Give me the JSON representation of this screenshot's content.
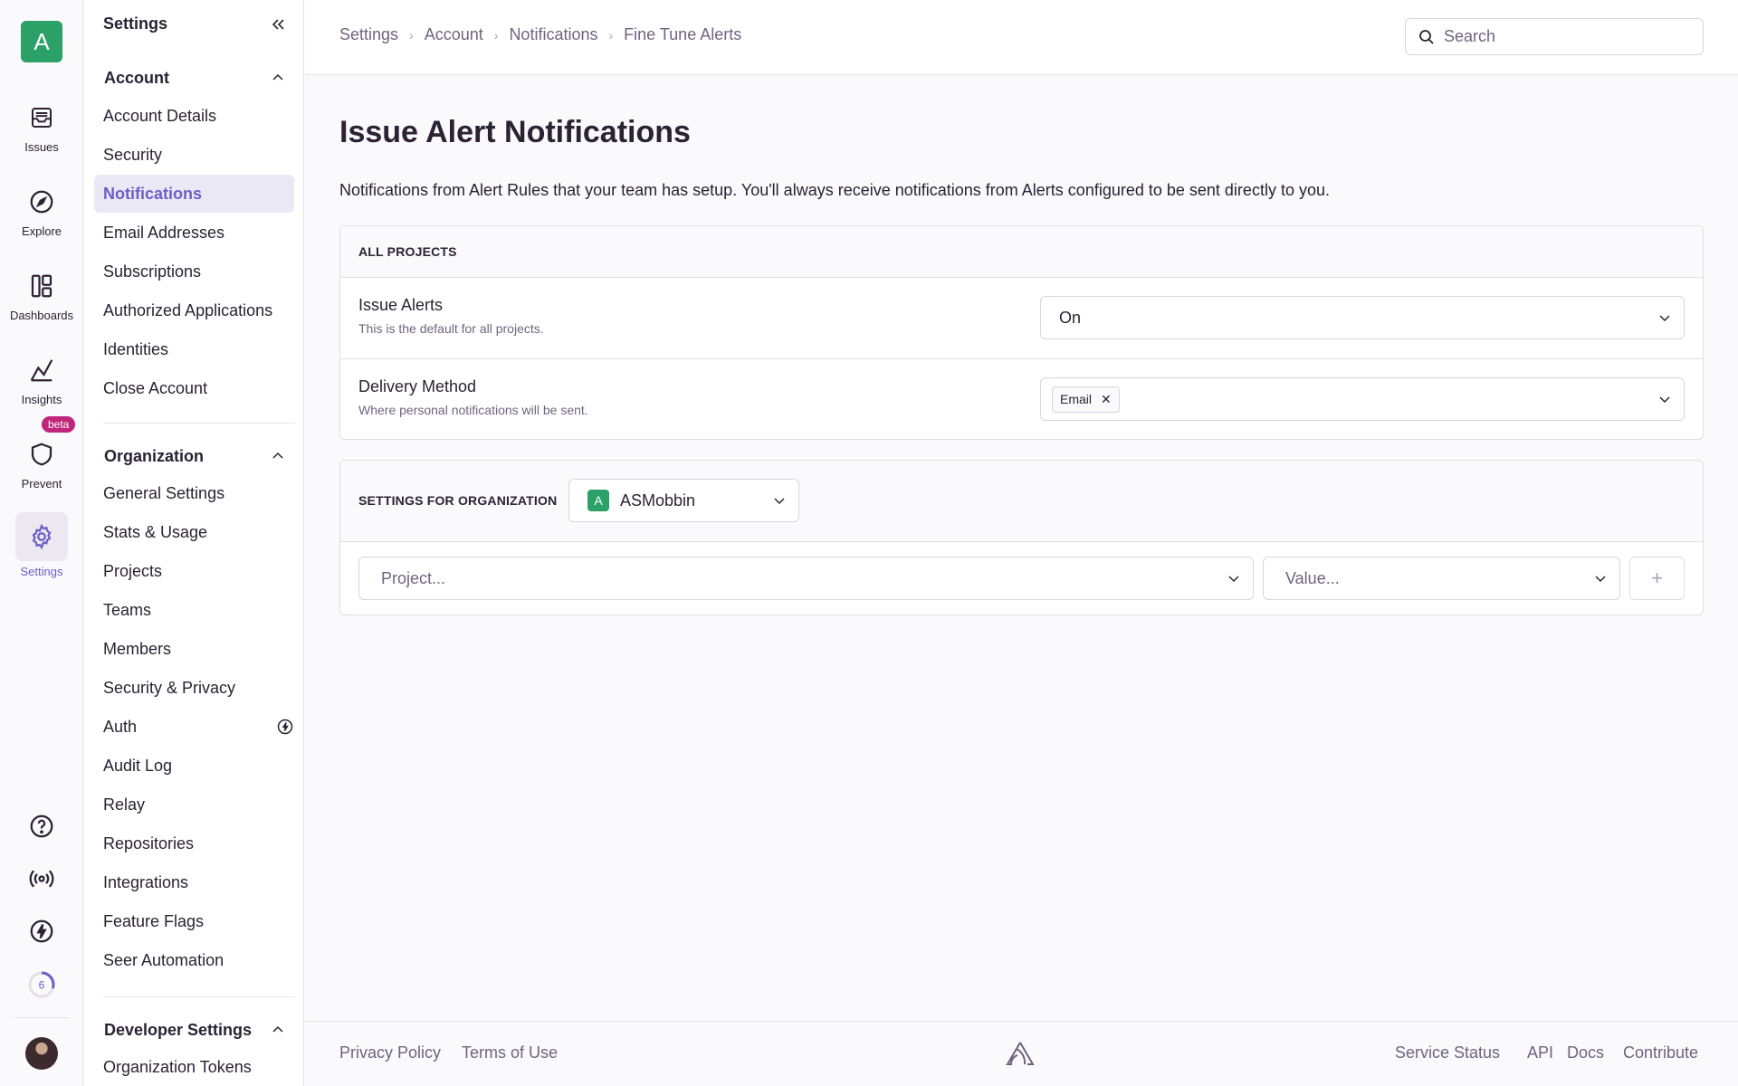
{
  "rail": {
    "org_initial": "A",
    "items": [
      {
        "label": "Issues",
        "icon": "inbox-icon"
      },
      {
        "label": "Explore",
        "icon": "compass-icon"
      },
      {
        "label": "Dashboards",
        "icon": "dashboard-icon"
      },
      {
        "label": "Insights",
        "icon": "chart-icon"
      },
      {
        "label": "Prevent",
        "icon": "shield-icon"
      },
      {
        "label": "Settings",
        "icon": "gear-icon"
      }
    ],
    "beta_badge": "beta",
    "onboarding_count": "6",
    "onboarding_progress": 0.3
  },
  "sidebar": {
    "title": "Settings",
    "account": {
      "heading": "Account",
      "items": [
        "Account Details",
        "Security",
        "Notifications",
        "Email Addresses",
        "Subscriptions",
        "Authorized Applications",
        "Identities",
        "Close Account"
      ]
    },
    "organization": {
      "heading": "Organization",
      "items": [
        "General Settings",
        "Stats & Usage",
        "Projects",
        "Teams",
        "Members",
        "Security & Privacy",
        "Auth",
        "Audit Log",
        "Relay",
        "Repositories",
        "Integrations",
        "Feature Flags",
        "Seer Automation"
      ]
    },
    "developer": {
      "heading": "Developer Settings",
      "items": [
        "Organization Tokens"
      ]
    }
  },
  "header": {
    "breadcrumbs": [
      "Settings",
      "Account",
      "Notifications",
      "Fine Tune Alerts"
    ],
    "search_placeholder": "Search"
  },
  "main": {
    "title": "Issue Alert Notifications",
    "description": "Notifications from Alert Rules that your team has setup. You'll always receive notifications from Alerts configured to be sent directly to you.",
    "all_projects": {
      "heading": "ALL PROJECTS",
      "issue_alerts": {
        "label": "Issue Alerts",
        "help": "This is the default for all projects.",
        "value": "On"
      },
      "delivery_method": {
        "label": "Delivery Method",
        "help": "Where personal notifications will be sent.",
        "tag": "Email"
      }
    },
    "org_settings": {
      "heading": "SETTINGS FOR ORGANIZATION",
      "org_initial": "A",
      "org_name": "ASMobbin",
      "project_placeholder": "Project...",
      "value_placeholder": "Value...",
      "add_label": "+"
    }
  },
  "footer": {
    "links": [
      "Privacy Policy",
      "Terms of Use"
    ],
    "right_links": [
      "Service Status",
      "API",
      "Docs",
      "Contribute"
    ]
  },
  "colors": {
    "accent": "#6c5fc7",
    "org_green": "#2ba168",
    "beta_pink": "#c0267a"
  }
}
